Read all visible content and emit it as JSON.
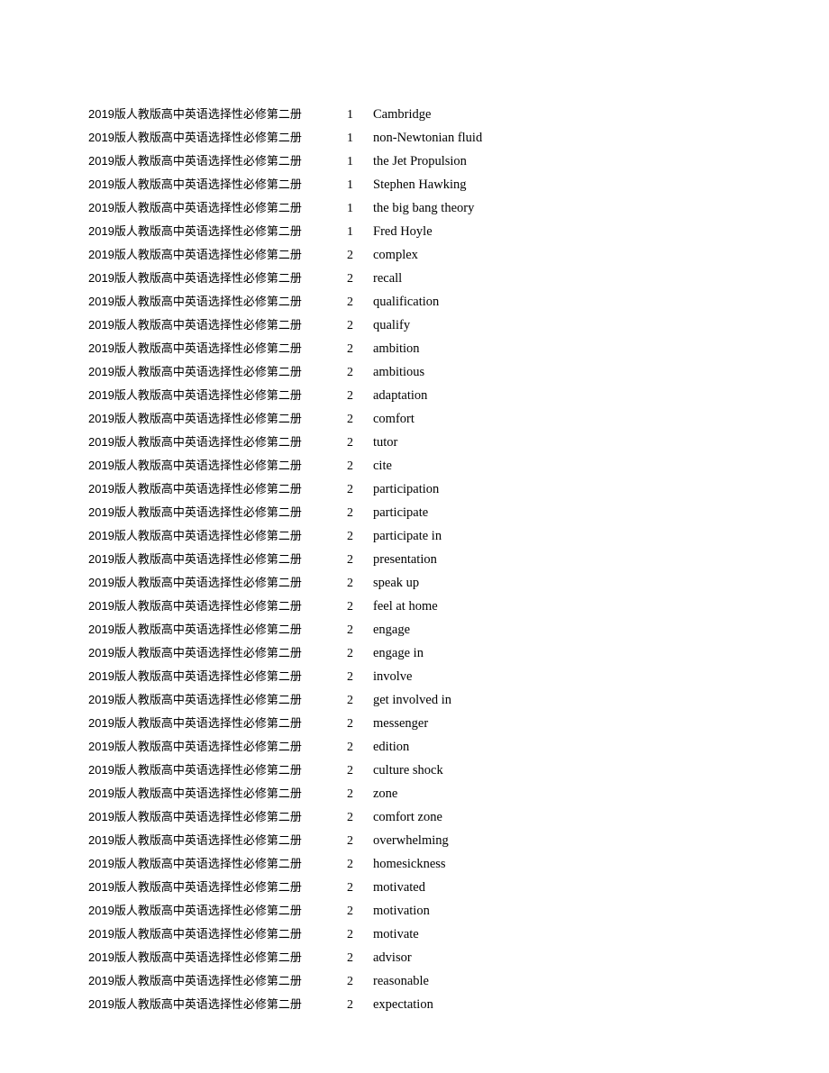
{
  "document": {
    "page_background": "#ffffff",
    "text_color": "#000000",
    "page_number_visible": false
  },
  "table": {
    "columns": [
      "textbook",
      "unit",
      "term"
    ],
    "rows": [
      {
        "textbook": "2019版人教版高中英语选择性必修第二册",
        "unit": "1",
        "term": "Cambridge"
      },
      {
        "textbook": "2019版人教版高中英语选择性必修第二册",
        "unit": "1",
        "term": "non-Newtonian fluid"
      },
      {
        "textbook": "2019版人教版高中英语选择性必修第二册",
        "unit": "1",
        "term": "the Jet Propulsion"
      },
      {
        "textbook": "2019版人教版高中英语选择性必修第二册",
        "unit": "1",
        "term": "Stephen Hawking"
      },
      {
        "textbook": "2019版人教版高中英语选择性必修第二册",
        "unit": "1",
        "term": "the big bang theory"
      },
      {
        "textbook": "2019版人教版高中英语选择性必修第二册",
        "unit": "1",
        "term": "Fred Hoyle"
      },
      {
        "textbook": "2019版人教版高中英语选择性必修第二册",
        "unit": "2",
        "term": "complex"
      },
      {
        "textbook": "2019版人教版高中英语选择性必修第二册",
        "unit": "2",
        "term": "recall"
      },
      {
        "textbook": "2019版人教版高中英语选择性必修第二册",
        "unit": "2",
        "term": "qualification"
      },
      {
        "textbook": "2019版人教版高中英语选择性必修第二册",
        "unit": "2",
        "term": "qualify"
      },
      {
        "textbook": "2019版人教版高中英语选择性必修第二册",
        "unit": "2",
        "term": "ambition"
      },
      {
        "textbook": "2019版人教版高中英语选择性必修第二册",
        "unit": "2",
        "term": "ambitious"
      },
      {
        "textbook": "2019版人教版高中英语选择性必修第二册",
        "unit": "2",
        "term": "adaptation"
      },
      {
        "textbook": "2019版人教版高中英语选择性必修第二册",
        "unit": "2",
        "term": "comfort"
      },
      {
        "textbook": "2019版人教版高中英语选择性必修第二册",
        "unit": "2",
        "term": "tutor"
      },
      {
        "textbook": "2019版人教版高中英语选择性必修第二册",
        "unit": "2",
        "term": "cite"
      },
      {
        "textbook": "2019版人教版高中英语选择性必修第二册",
        "unit": "2",
        "term": "participation"
      },
      {
        "textbook": "2019版人教版高中英语选择性必修第二册",
        "unit": "2",
        "term": "participate"
      },
      {
        "textbook": "2019版人教版高中英语选择性必修第二册",
        "unit": "2",
        "term": "participate in"
      },
      {
        "textbook": "2019版人教版高中英语选择性必修第二册",
        "unit": "2",
        "term": "presentation"
      },
      {
        "textbook": "2019版人教版高中英语选择性必修第二册",
        "unit": "2",
        "term": "speak up"
      },
      {
        "textbook": "2019版人教版高中英语选择性必修第二册",
        "unit": "2",
        "term": "feel at home"
      },
      {
        "textbook": "2019版人教版高中英语选择性必修第二册",
        "unit": "2",
        "term": "engage"
      },
      {
        "textbook": "2019版人教版高中英语选择性必修第二册",
        "unit": "2",
        "term": "engage in"
      },
      {
        "textbook": "2019版人教版高中英语选择性必修第二册",
        "unit": "2",
        "term": "involve"
      },
      {
        "textbook": "2019版人教版高中英语选择性必修第二册",
        "unit": "2",
        "term": "get involved in"
      },
      {
        "textbook": "2019版人教版高中英语选择性必修第二册",
        "unit": "2",
        "term": "messenger"
      },
      {
        "textbook": "2019版人教版高中英语选择性必修第二册",
        "unit": "2",
        "term": "edition"
      },
      {
        "textbook": "2019版人教版高中英语选择性必修第二册",
        "unit": "2",
        "term": "culture shock"
      },
      {
        "textbook": "2019版人教版高中英语选择性必修第二册",
        "unit": "2",
        "term": "zone"
      },
      {
        "textbook": "2019版人教版高中英语选择性必修第二册",
        "unit": "2",
        "term": "comfort zone"
      },
      {
        "textbook": "2019版人教版高中英语选择性必修第二册",
        "unit": "2",
        "term": "overwhelming"
      },
      {
        "textbook": "2019版人教版高中英语选择性必修第二册",
        "unit": "2",
        "term": "homesickness"
      },
      {
        "textbook": "2019版人教版高中英语选择性必修第二册",
        "unit": "2",
        "term": "motivated"
      },
      {
        "textbook": "2019版人教版高中英语选择性必修第二册",
        "unit": "2",
        "term": "motivation"
      },
      {
        "textbook": "2019版人教版高中英语选择性必修第二册",
        "unit": "2",
        "term": "motivate"
      },
      {
        "textbook": "2019版人教版高中英语选择性必修第二册",
        "unit": "2",
        "term": "advisor"
      },
      {
        "textbook": "2019版人教版高中英语选择性必修第二册",
        "unit": "2",
        "term": "reasonable"
      },
      {
        "textbook": "2019版人教版高中英语选择性必修第二册",
        "unit": "2",
        "term": "expectation"
      }
    ]
  }
}
